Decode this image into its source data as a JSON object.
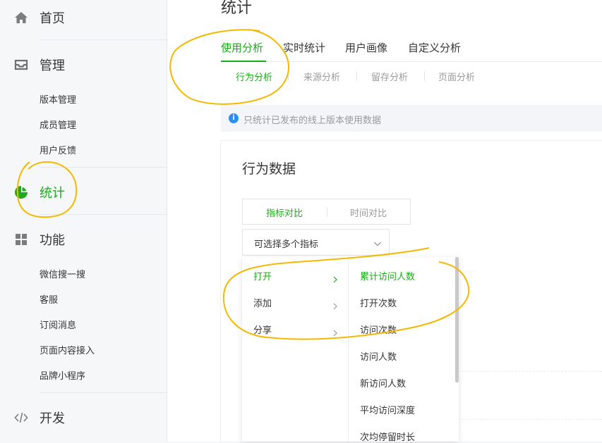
{
  "sidebar": {
    "home": "首页",
    "manage": "管理",
    "manage_items": [
      "版本管理",
      "成员管理",
      "用户反馈"
    ],
    "stats": "统计",
    "features": "功能",
    "features_items": [
      "微信搜一搜",
      "客服",
      "订阅消息",
      "页面内容接入",
      "品牌小程序"
    ],
    "dev": "开发"
  },
  "page": {
    "title": "统计",
    "tabs": [
      "使用分析",
      "实时统计",
      "用户画像",
      "自定义分析"
    ],
    "subtabs": [
      "行为分析",
      "来源分析",
      "留存分析",
      "页面分析"
    ],
    "notice": "只统计已发布的线上版本使用数据"
  },
  "card": {
    "title": "行为数据",
    "segment": [
      "指标对比",
      "时间对比"
    ],
    "select_placeholder": "可选择多个指标",
    "dropdown": {
      "groups": [
        "打开",
        "添加",
        "分享"
      ],
      "metrics": [
        "累计访问人数",
        "打开次数",
        "访问次数",
        "访问人数",
        "新访问人数",
        "平均访问深度",
        "次均停留时长"
      ]
    }
  },
  "colors": {
    "accent": "#1aad19",
    "annotation": "#f5b800",
    "info": "#2a8ff2"
  },
  "icons": [
    "home-icon",
    "inbox-icon",
    "pie-chart-icon",
    "grid-icon",
    "code-icon",
    "info-icon",
    "chevron-right-icon",
    "chevron-down-icon"
  ]
}
